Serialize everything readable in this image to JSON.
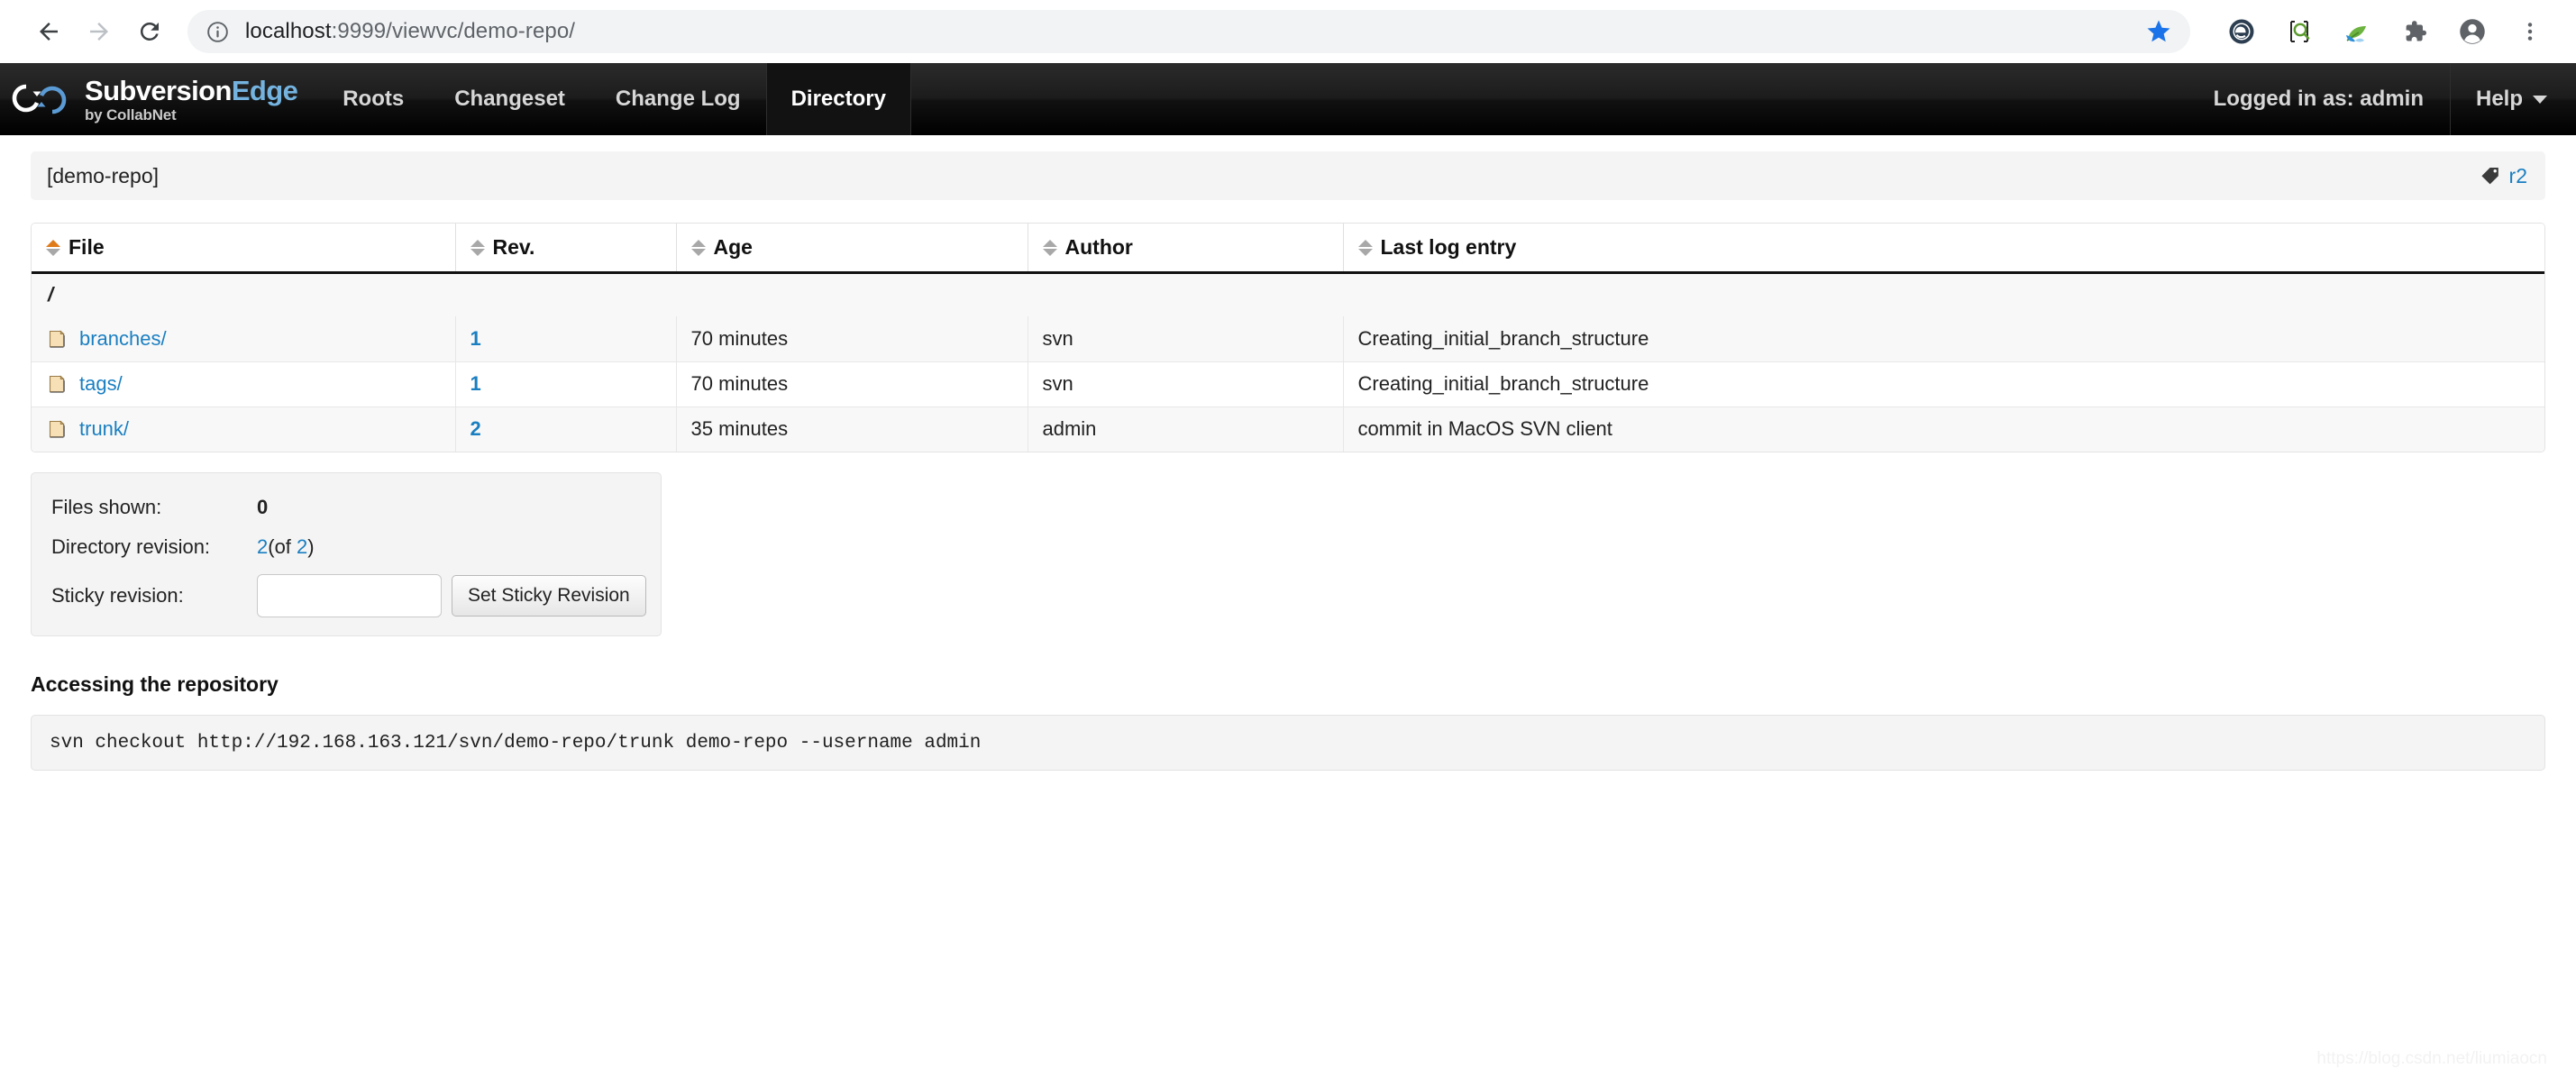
{
  "browser": {
    "back_label": "Back",
    "forward_label": "Forward",
    "reload_label": "Reload",
    "site_info_label": "Site information",
    "url_host": "localhost",
    "url_rest": ":9999/viewvc/demo-repo/",
    "bookmark_label": "Bookmark this tab",
    "toolbar_icons": [
      {
        "name": "extension-eclipse-icon",
        "label": "Eclipse extension"
      },
      {
        "name": "extension-inspect-icon",
        "label": "Inspect element extension"
      },
      {
        "name": "extension-leaf-icon",
        "label": "Leaf extension"
      },
      {
        "name": "extensions-puzzle-icon",
        "label": "Extensions"
      },
      {
        "name": "profile-avatar-icon",
        "label": "Profile"
      },
      {
        "name": "chrome-menu-icon",
        "label": "Customize and control"
      }
    ]
  },
  "topnav": {
    "brand_main": "Subversion",
    "brand_accent": "Edge",
    "brand_sub": "by CollabNet",
    "items": [
      {
        "label": "Roots",
        "active": false
      },
      {
        "label": "Changeset",
        "active": false
      },
      {
        "label": "Change Log",
        "active": false
      },
      {
        "label": "Directory",
        "active": true
      }
    ],
    "user_label": "Logged in as: admin",
    "help_label": "Help"
  },
  "repo_bar": {
    "repo_name": "[demo-repo]",
    "revision_label": "r2"
  },
  "directory": {
    "path": "/",
    "columns": [
      {
        "label": "File",
        "sort": "asc"
      },
      {
        "label": "Rev.",
        "sort": "none"
      },
      {
        "label": "Age",
        "sort": "none"
      },
      {
        "label": "Author",
        "sort": "none"
      },
      {
        "label": "Last log entry",
        "sort": "none"
      }
    ],
    "rows": [
      {
        "file": "branches/",
        "rev": "1",
        "age": "70 minutes",
        "author": "svn",
        "log": "Creating_initial_branch_structure"
      },
      {
        "file": "tags/",
        "rev": "1",
        "age": "70 minutes",
        "author": "svn",
        "log": "Creating_initial_branch_structure"
      },
      {
        "file": "trunk/",
        "rev": "2",
        "age": "35 minutes",
        "author": "admin",
        "log": "commit in MacOS SVN client"
      }
    ]
  },
  "infobox": {
    "files_shown_label": "Files shown:",
    "files_shown_value": "0",
    "dir_rev_label": "Directory revision:",
    "dir_rev_value": "2",
    "dir_rev_of_open": "(of ",
    "dir_rev_total": "2",
    "dir_rev_of_close": ")",
    "sticky_label": "Sticky revision:",
    "sticky_value": "",
    "sticky_placeholder": "",
    "sticky_button": "Set Sticky Revision"
  },
  "access": {
    "title": "Accessing the repository",
    "command": "svn checkout http://192.168.163.121/svn/demo-repo/trunk demo-repo --username admin"
  },
  "watermark": "https://blog.csdn.net/liumiaocn",
  "colors": {
    "link": "#1a7fc1",
    "accent_edge": "#74b3e0",
    "sort_active": "#e07b1a",
    "bookmark_star": "#1a73e8"
  }
}
